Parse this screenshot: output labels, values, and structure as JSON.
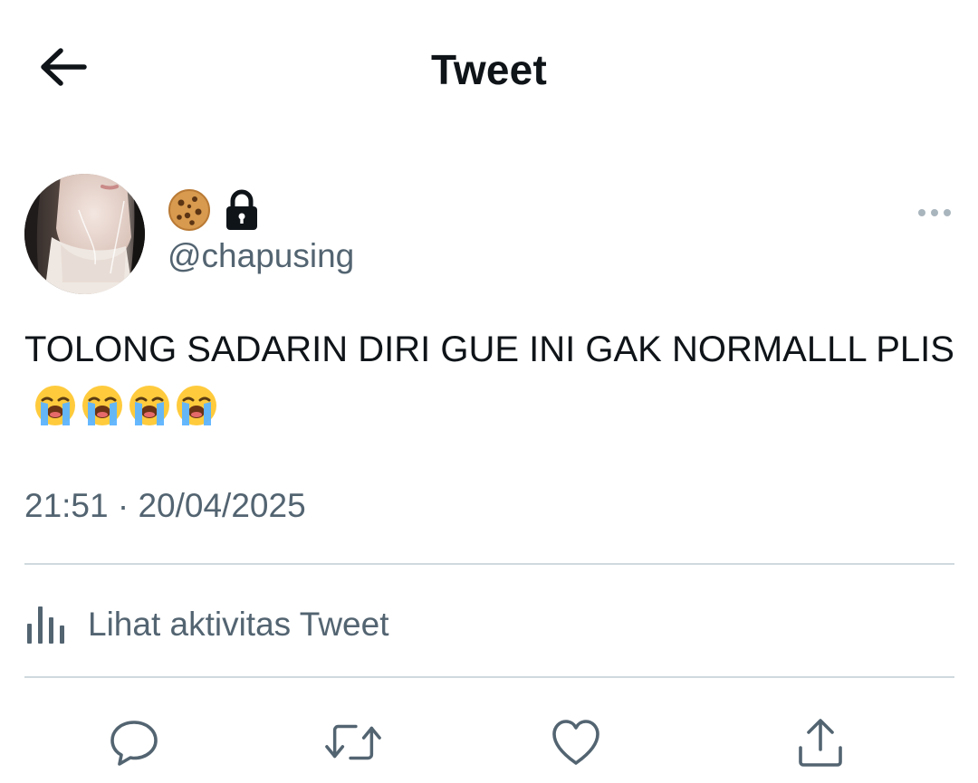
{
  "header": {
    "title": "Tweet",
    "back_icon": "arrow-left-icon"
  },
  "author": {
    "display_name_icons": [
      "cookie-emoji",
      "lock-icon"
    ],
    "handle": "@chapusing",
    "more_icon": "more-horizontal-icon"
  },
  "tweet": {
    "text": "TOLONG SADARIN DIRI GUE INI GAK NORMALLL PLIS",
    "emojis": [
      "loudly-crying-face",
      "loudly-crying-face",
      "loudly-crying-face",
      "loudly-crying-face"
    ],
    "timestamp": "21:51 · 20/04/2025"
  },
  "activity": {
    "label": "Lihat aktivitas Tweet",
    "icon": "bar-chart-icon"
  },
  "actions": [
    {
      "name": "reply",
      "icon": "reply-icon"
    },
    {
      "name": "retweet",
      "icon": "retweet-icon"
    },
    {
      "name": "like",
      "icon": "heart-icon"
    },
    {
      "name": "share",
      "icon": "share-icon"
    }
  ],
  "colors": {
    "text_primary": "#0f1419",
    "text_secondary": "#536471",
    "divider": "#cfd9de",
    "background": "#ffffff"
  }
}
